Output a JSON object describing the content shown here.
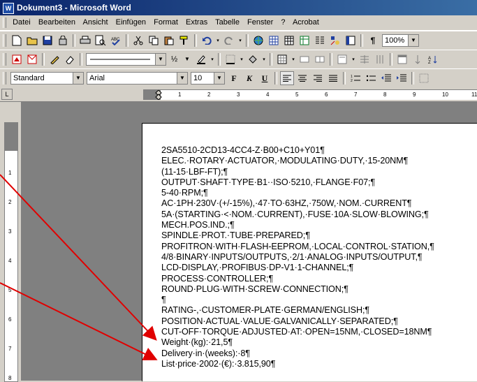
{
  "window": {
    "title": "Dokument3 - Microsoft Word",
    "app_icon_letter": "W"
  },
  "menu": [
    "Datei",
    "Bearbeiten",
    "Ansicht",
    "Einfügen",
    "Format",
    "Extras",
    "Tabelle",
    "Fenster",
    "?",
    "Acrobat"
  ],
  "toolbar": {
    "zoom": "100%",
    "style": "Standard",
    "font": "Arial",
    "size": "10",
    "line_width": "½"
  },
  "ruler": {
    "h_ticks": [
      "1",
      "2",
      "3",
      "4",
      "5",
      "6",
      "7",
      "8",
      "9",
      "10",
      "11"
    ],
    "v_ticks": [
      "1",
      "2",
      "3",
      "4",
      "5",
      "6",
      "7",
      "8"
    ]
  },
  "document": {
    "lines": [
      "2SA5510-2CD13-4CC4-Z·B00+C10+Y01¶",
      "ELEC.·ROTARY·ACTUATOR,·MODULATING·DUTY,·15-20NM¶",
      "(11-15·LBF-FT);¶",
      "OUTPUT·SHAFT·TYPE·B1··ISO·5210,·FLANGE·F07;¶",
      "5-40·RPM;¶",
      "AC·1PH·230V·(+/-15%),·47·TO·63HZ,·750W,·NOM.·CURRENT¶",
      "5A·(STARTING·<·NOM.·CURRENT),·FUSE·10A·SLOW·BLOWING;¶",
      "MECH.POS.IND.;¶",
      "SPINDLE·PROT.·TUBE·PREPARED;¶",
      "PROFITRON·WITH·FLASH-EEPROM,·LOCAL·CONTROL·STATION,¶",
      "4/8·BINARY·INPUTS/OUTPUTS,·2/1·ANALOG·INPUTS/OUTPUT,¶",
      "LCD-DISPLAY,·PROFIBUS·DP-V1·1-CHANNEL;¶",
      "PROCESS·CONTROLLER;¶",
      "ROUND·PLUG·WITH·SCREW·CONNECTION;¶",
      "¶",
      "RATING-,·CUSTOMER-PLATE·GERMAN/ENGLISH;¶",
      "POSITION·ACTUAL·VALUE·GALVANICALLY·SEPARATED;¶",
      "CUT-OFF·TORQUE·ADJUSTED·AT:·OPEN=15NM,·CLOSED=18NM¶",
      "Weight·(kg):·21,5¶",
      "Delivery·in·(weeks):·8¶",
      "List·price·2002·(€):·3.815,90¶"
    ]
  },
  "colors": {
    "title_start": "#0a246a",
    "title_end": "#3a6ea5",
    "arrow": "#e00000"
  }
}
